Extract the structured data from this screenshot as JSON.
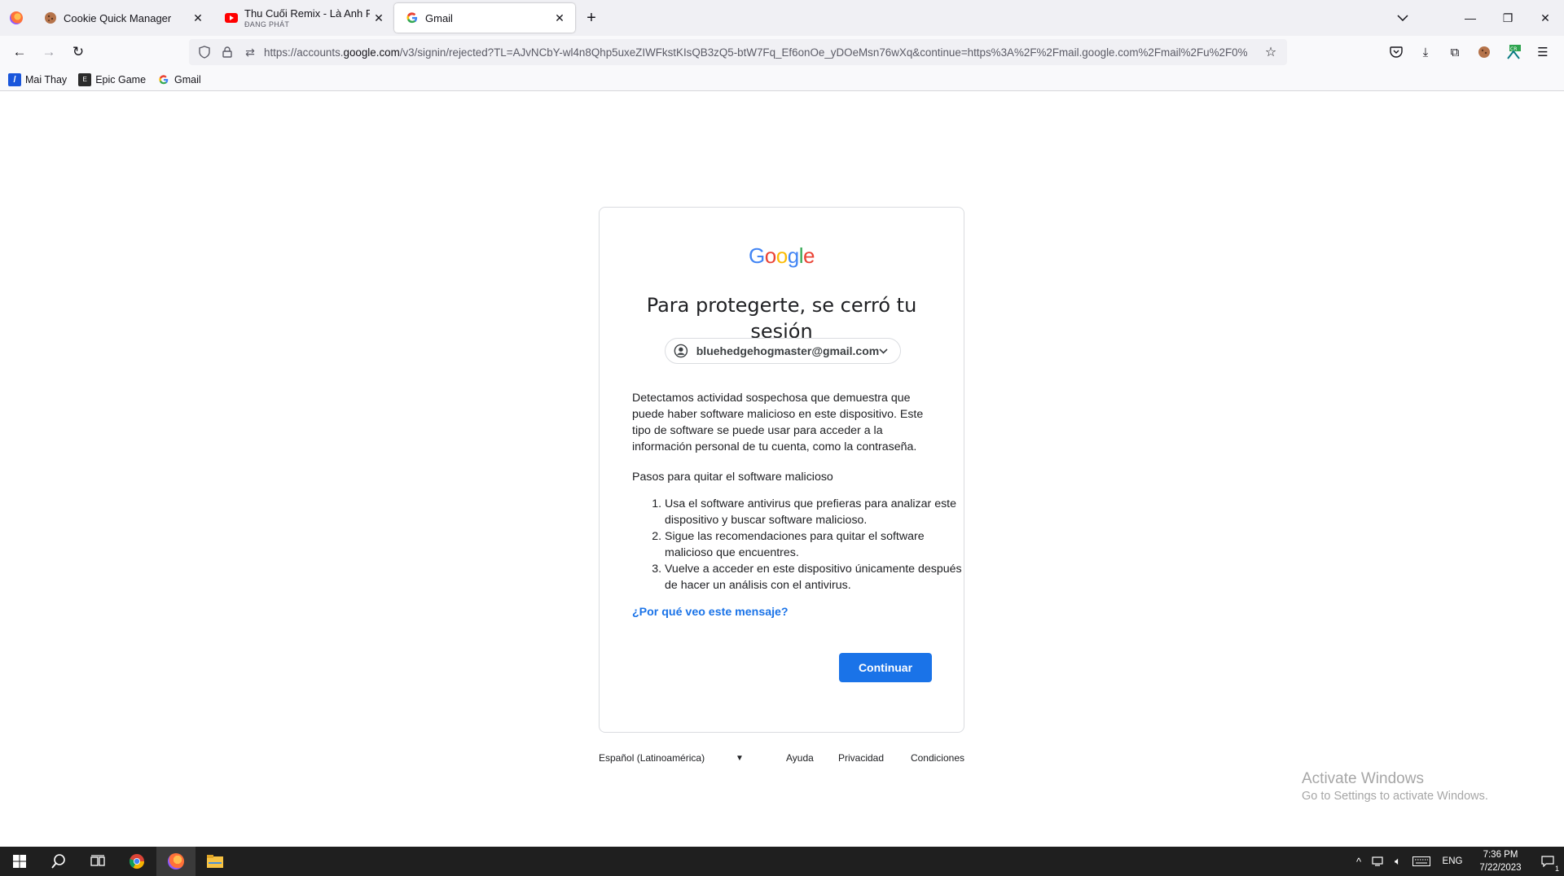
{
  "browser": {
    "tabs": [
      {
        "title": "Cookie Quick Manager",
        "subtitle": "",
        "active": false
      },
      {
        "title": "Thu Cuối Remix - Là Anh Remix",
        "subtitle": "ĐANG PHÁT",
        "active": false
      },
      {
        "title": "Gmail",
        "subtitle": "",
        "active": true
      }
    ],
    "url_prefix": "https://accounts.",
    "url_domain": "google.com",
    "url_rest": "/v3/signin/rejected?TL=AJvNCbY-wl4n8Qhp5uxeZIWFkstKIsQB3zQ5-btW7Fq_Ef6onOe_yDOeMsn76wXq&continue=https%3A%2F%2Fmail.google.com%2Fmail%2Fu%2F0%",
    "bookmarks": [
      "Mai Thay",
      "Epic Game",
      "Gmail"
    ]
  },
  "page": {
    "logo": "Google",
    "heading": "Para protegerte, se cerró tu sesión",
    "account_email": "bluehedgehogmaster@gmail.com",
    "body": "Detectamos actividad sospechosa que demuestra que puede haber software malicioso en este dispositivo. Este tipo de software se puede usar para acceder a la información personal de tu cuenta, como la contraseña.",
    "steps_title": "Pasos para quitar el software malicioso",
    "steps": [
      "Usa el software antivirus que prefieras para analizar este dispositivo y buscar software malicioso.",
      "Sigue las recomendaciones para quitar el software malicioso que encuentres.",
      "Vuelve a acceder en este dispositivo únicamente después de hacer un análisis con el antivirus."
    ],
    "why_link": "¿Por qué veo este mensaje?",
    "continue_label": "Continuar"
  },
  "footer": {
    "language": "Español (Latinoamérica)",
    "help": "Ayuda",
    "privacy": "Privacidad",
    "terms": "Condiciones"
  },
  "watermark": {
    "line1": "Activate Windows",
    "line2": "Go to Settings to activate Windows."
  },
  "taskbar": {
    "lang": "ENG",
    "time": "7:36 PM",
    "date": "7/22/2023",
    "notifications": "1"
  },
  "colors": {
    "google_blue": "#1a73e8",
    "taskbar_bg": "#1f1f1f"
  }
}
